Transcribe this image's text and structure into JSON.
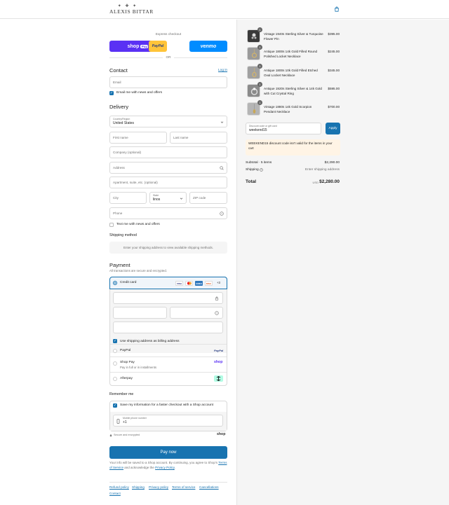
{
  "header": {
    "logo_mark": "✦ ✚ ✦",
    "logo_text": "ALEXIS BITTAR",
    "cart_icon": "shopping-bag-icon"
  },
  "express": {
    "label": "Express checkout",
    "shop_pay": "shop",
    "shop_pay_badge": "Pay",
    "paypal": "PayPal",
    "venmo": "venmo",
    "or": "OR"
  },
  "contact": {
    "title": "Contact",
    "login": "Log in",
    "email_placeholder": "Email",
    "email_news": "Email me with news and offers"
  },
  "delivery": {
    "title": "Delivery",
    "country_label": "Country/Region",
    "country_value": "United States",
    "first_name": "First name",
    "last_name": "Last name",
    "company": "Company (optional)",
    "address": "Address",
    "apartment": "Apartment, suite, etc. (optional)",
    "city": "City",
    "state_label": "State",
    "state_value": "linos",
    "zip": "ZIP code",
    "phone": "Phone",
    "text_news": "Text me with news and offers"
  },
  "shipping_method": {
    "title": "Shipping method",
    "message": "Enter your shipping address to view available shipping methods."
  },
  "payment": {
    "title": "Payment",
    "subtitle": "All transactions are secure and encrypted.",
    "credit_card": "Credit card",
    "brands": [
      "VISA",
      "MC",
      "AMEX",
      "DISC"
    ],
    "more_brands": "+3",
    "billing_same": "Use shipping address as billing address",
    "paypal": "PayPal",
    "paypal_logo": "PayPal",
    "shop_pay": "Shop Pay",
    "shop_pay_sub": "Pay in full or in installments",
    "shop_logo": "shop",
    "afterpay": "Afterpay"
  },
  "remember": {
    "title": "Remember me",
    "save_info": "Save my information for a faster checkout with a Shop account",
    "mobile_label": "Mobile phone number",
    "mobile_value": "+1",
    "secure": "Secure and encrypted",
    "shop_logo": "shop"
  },
  "pay_now": "Pay now",
  "terms": {
    "line1": "Your info will be saved to a Shop account. By continuing, you agree to Shop's",
    "tos": "Terms of Service",
    "and": "and acknowledge the",
    "privacy": "Privacy Policy",
    "end": "."
  },
  "footer": {
    "links": [
      "Refund policy",
      "Shipping",
      "Privacy policy",
      "Terms of service",
      "Cancellations",
      "Contact"
    ]
  },
  "order": {
    "items": [
      {
        "name": "Vintage 1940s Sterling Silver & Turquoise Flower Pin",
        "price": "$395.00",
        "qty": "1"
      },
      {
        "name": "Antique 1800s 14k Gold Filled Round Polished Locket Necklace",
        "price": "$245.00",
        "qty": "1"
      },
      {
        "name": "Antique 1800s 10k Gold Filled Etched Oval Locket Necklace",
        "price": "$345.00",
        "qty": "1"
      },
      {
        "name": "Antique 1920s Sterling Silver & 14k Gold with Cut Crystal Ring",
        "price": "$595.00",
        "qty": "1"
      },
      {
        "name": "Vintage 1880s 14k Gold Scorpion Pendant Necklace",
        "price": "$700.00",
        "qty": "1"
      }
    ],
    "discount_label": "Discount code or gift card",
    "discount_value": "weekend15",
    "apply": "Apply",
    "warning": "WEEKEND15 discount code isn't valid for the items in your cart",
    "subtotal_label": "Subtotal · 5 items",
    "subtotal_value": "$2,290.00",
    "shipping_label": "Shipping",
    "shipping_value": "Enter shipping address",
    "total_label": "Total",
    "currency": "USD",
    "total_value": "$2,280.00"
  }
}
